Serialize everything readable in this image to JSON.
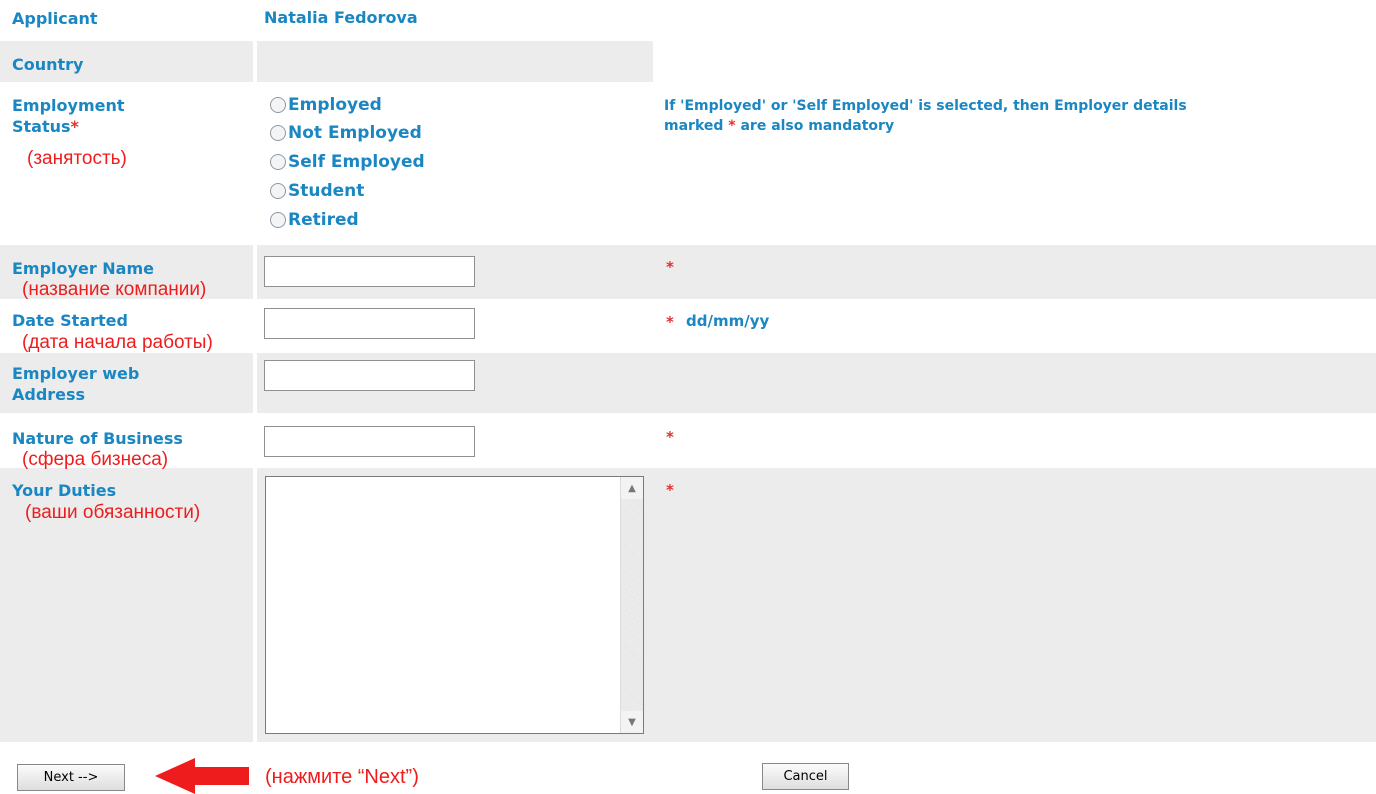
{
  "applicant": {
    "label": "Applicant",
    "value": "Natalia Fedorova"
  },
  "country": {
    "label": "Country"
  },
  "employment_status": {
    "label_line1": "Employment",
    "label_line2": "Status",
    "required_mark": "*",
    "ru_note": "(занятость)",
    "options": [
      "Employed",
      "Not Employed",
      "Self Employed",
      "Student",
      "Retired"
    ],
    "note_line1": "If 'Employed' or 'Self Employed' is selected, then Employer details",
    "note_line2_pre": "marked",
    "note_star": "*",
    "note_line2_post": "are also mandatory"
  },
  "employer_name": {
    "label": "Employer Name",
    "ru_note": "(название компании)",
    "required_mark": "*",
    "value": ""
  },
  "date_started": {
    "label": "Date Started",
    "ru_note": "(дата начала работы)",
    "required_mark": "*",
    "hint": "dd/mm/yy",
    "value": ""
  },
  "employer_web": {
    "label_line1": "Employer web",
    "label_line2": "Address",
    "value": ""
  },
  "nature_of_business": {
    "label": "Nature of Business",
    "ru_note": "(сфера бизнеса)",
    "required_mark": "*",
    "value": ""
  },
  "your_duties": {
    "label": "Your Duties",
    "ru_note": "(ваши обязанности)",
    "required_mark": "*",
    "value": ""
  },
  "footer": {
    "next_label": "Next -->",
    "next_ru_note": "(нажмите “Next”)",
    "cancel_label": "Cancel",
    "arrow_color": "#ee1c1c"
  },
  "colors": {
    "label": "#1a86c2",
    "required": "#e53030",
    "russian_note": "#ee1c1c",
    "row_gray": "#ececec"
  }
}
